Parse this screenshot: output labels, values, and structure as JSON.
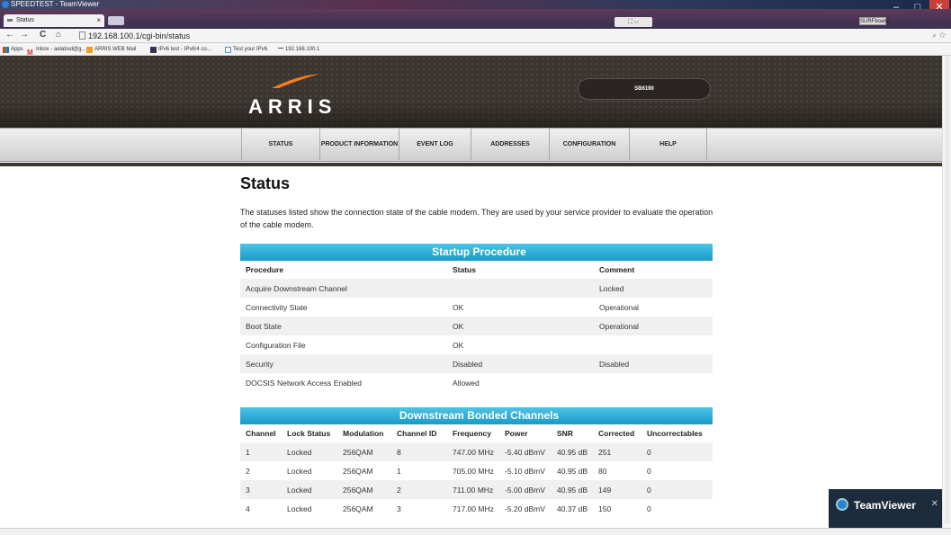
{
  "window": {
    "title": "SPEEDTEST - TeamViewer",
    "surfboard_btn": "SURFboard"
  },
  "browser": {
    "tab_title": "Status",
    "url": "192.168.100.1/cgi-bin/status",
    "bookmarks": [
      {
        "label": "Apps",
        "icon": "apps-icon"
      },
      {
        "label": "Inbox - aelabsd@g...",
        "icon": "gmail-icon"
      },
      {
        "label": "ARRIS WEB Mail",
        "icon": "outlook-icon"
      },
      {
        "label": "IPv6 test - IPv6/4 co...",
        "icon": "ipv6-icon"
      },
      {
        "label": "Test your IPv6.",
        "icon": "ipv6-test-icon"
      },
      {
        "label": "192.168.100.1",
        "icon": "page-icon"
      }
    ]
  },
  "header": {
    "logo": "ARRIS",
    "model": "SB6190"
  },
  "nav": [
    "STATUS",
    "PRODUCT INFORMATION",
    "EVENT LOG",
    "ADDRESSES",
    "CONFIGURATION",
    "HELP"
  ],
  "page": {
    "title": "Status",
    "intro": "The statuses listed show the connection state of the cable modem. They are used by your service provider to evaluate the operation of the cable modem."
  },
  "startup": {
    "title": "Startup Procedure",
    "headers": [
      "Procedure",
      "Status",
      "Comment"
    ],
    "rows": [
      [
        "Acquire Downstream Channel",
        "",
        "Locked"
      ],
      [
        "Connectivity State",
        "OK",
        "Operational"
      ],
      [
        "Boot State",
        "OK",
        "Operational"
      ],
      [
        "Configuration File",
        "OK",
        ""
      ],
      [
        "Security",
        "Disabled",
        "Disabled"
      ],
      [
        "DOCSIS Network Access Enabled",
        "Allowed",
        ""
      ]
    ]
  },
  "downstream": {
    "title": "Downstream Bonded Channels",
    "headers": [
      "Channel",
      "Lock Status",
      "Modulation",
      "Channel ID",
      "Frequency",
      "Power",
      "SNR",
      "Corrected",
      "Uncorrectables"
    ],
    "rows": [
      [
        "1",
        "Locked",
        "256QAM",
        "8",
        "747.00 MHz",
        "-5.40 dBmV",
        "40.95 dB",
        "251",
        "0"
      ],
      [
        "2",
        "Locked",
        "256QAM",
        "1",
        "705.00 MHz",
        "-5.10 dBmV",
        "40.95 dB",
        "80",
        "0"
      ],
      [
        "3",
        "Locked",
        "256QAM",
        "2",
        "711.00 MHz",
        "-5.00 dBmV",
        "40.95 dB",
        "149",
        "0"
      ],
      [
        "4",
        "Locked",
        "256QAM",
        "3",
        "717.00 MHz",
        "-5.20 dBmV",
        "40.37 dB",
        "150",
        "0"
      ]
    ]
  },
  "teamviewer": {
    "label": "TeamViewer"
  },
  "colors": {
    "accent": "#1a9ac8",
    "header_bg": "#3b3530"
  }
}
